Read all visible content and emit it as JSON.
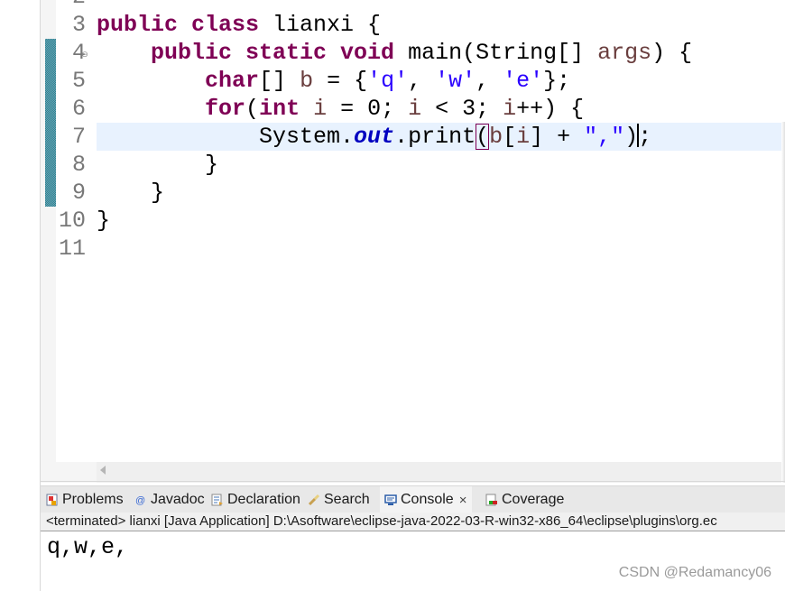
{
  "editor": {
    "line_numbers": [
      "2",
      "3",
      "4",
      "5",
      "6",
      "7",
      "8",
      "9",
      "10",
      "11"
    ],
    "lines": [
      {
        "num": "3",
        "segments": [
          [
            "kw",
            "public class"
          ],
          [
            "",
            " lianxi {"
          ]
        ]
      },
      {
        "num": "4",
        "segments": [
          [
            "",
            "    "
          ],
          [
            "kw",
            "public static void"
          ],
          [
            "",
            " main(String[] "
          ],
          [
            "var",
            "args"
          ],
          [
            "",
            ") {"
          ]
        ]
      },
      {
        "num": "5",
        "segments": [
          [
            "",
            "        "
          ],
          [
            "kw",
            "char"
          ],
          [
            "",
            "[] "
          ],
          [
            "var",
            "b"
          ],
          [
            "",
            " = {"
          ],
          [
            "str",
            "'q'"
          ],
          [
            "",
            ", "
          ],
          [
            "str",
            "'w'"
          ],
          [
            "",
            ", "
          ],
          [
            "str",
            "'e'"
          ],
          [
            "",
            "};"
          ]
        ]
      },
      {
        "num": "6",
        "segments": [
          [
            "",
            "        "
          ],
          [
            "kw",
            "for"
          ],
          [
            "",
            "("
          ],
          [
            "kw",
            "int"
          ],
          [
            "",
            " "
          ],
          [
            "var",
            "i"
          ],
          [
            "",
            " = 0; "
          ],
          [
            "var",
            "i"
          ],
          [
            "",
            " < 3; "
          ],
          [
            "var",
            "i"
          ],
          [
            "",
            "++) {"
          ]
        ]
      },
      {
        "num": "7",
        "segments": [
          [
            "",
            "            System."
          ],
          [
            "field",
            "out"
          ],
          [
            "",
            ".print"
          ],
          [
            "box",
            "("
          ],
          [
            "var",
            "b"
          ],
          [
            "",
            "["
          ],
          [
            "var",
            "i"
          ],
          [
            "",
            "] + "
          ],
          [
            "str",
            "\",\""
          ],
          [
            "",
            ")"
          ],
          [
            "caret",
            ""
          ],
          [
            "",
            ";"
          ]
        ]
      },
      {
        "num": "8",
        "segments": [
          [
            "",
            "        }"
          ]
        ]
      },
      {
        "num": "9",
        "segments": [
          [
            "",
            "    }"
          ]
        ]
      },
      {
        "num": "10",
        "segments": [
          [
            "",
            "}"
          ]
        ]
      },
      {
        "num": "11",
        "segments": []
      }
    ],
    "fold_icon_line": "4"
  },
  "bottom_panel": {
    "tabs": [
      {
        "label": "Problems",
        "icon": "problems-icon"
      },
      {
        "label": "Javadoc",
        "icon": "javadoc-icon"
      },
      {
        "label": "Declaration",
        "icon": "declaration-icon"
      },
      {
        "label": "Search",
        "icon": "search-icon"
      },
      {
        "label": "Console",
        "icon": "console-icon",
        "active": true,
        "closable": true
      },
      {
        "label": "Coverage",
        "icon": "coverage-icon"
      }
    ],
    "console_header": "<terminated> lianxi [Java Application] D:\\Asoftware\\eclipse-java-2022-03-R-win32-x86_64\\eclipse\\plugins\\org.ec",
    "console_output": "q,w,e,",
    "close_glyph": "×"
  },
  "watermark": "CSDN @Redamancy06",
  "colors": {
    "keyword": "#7f0055",
    "string": "#2a00ff",
    "field": "#0000c0",
    "variable": "#6a3e3e",
    "current_line": "#e8f2fe"
  }
}
